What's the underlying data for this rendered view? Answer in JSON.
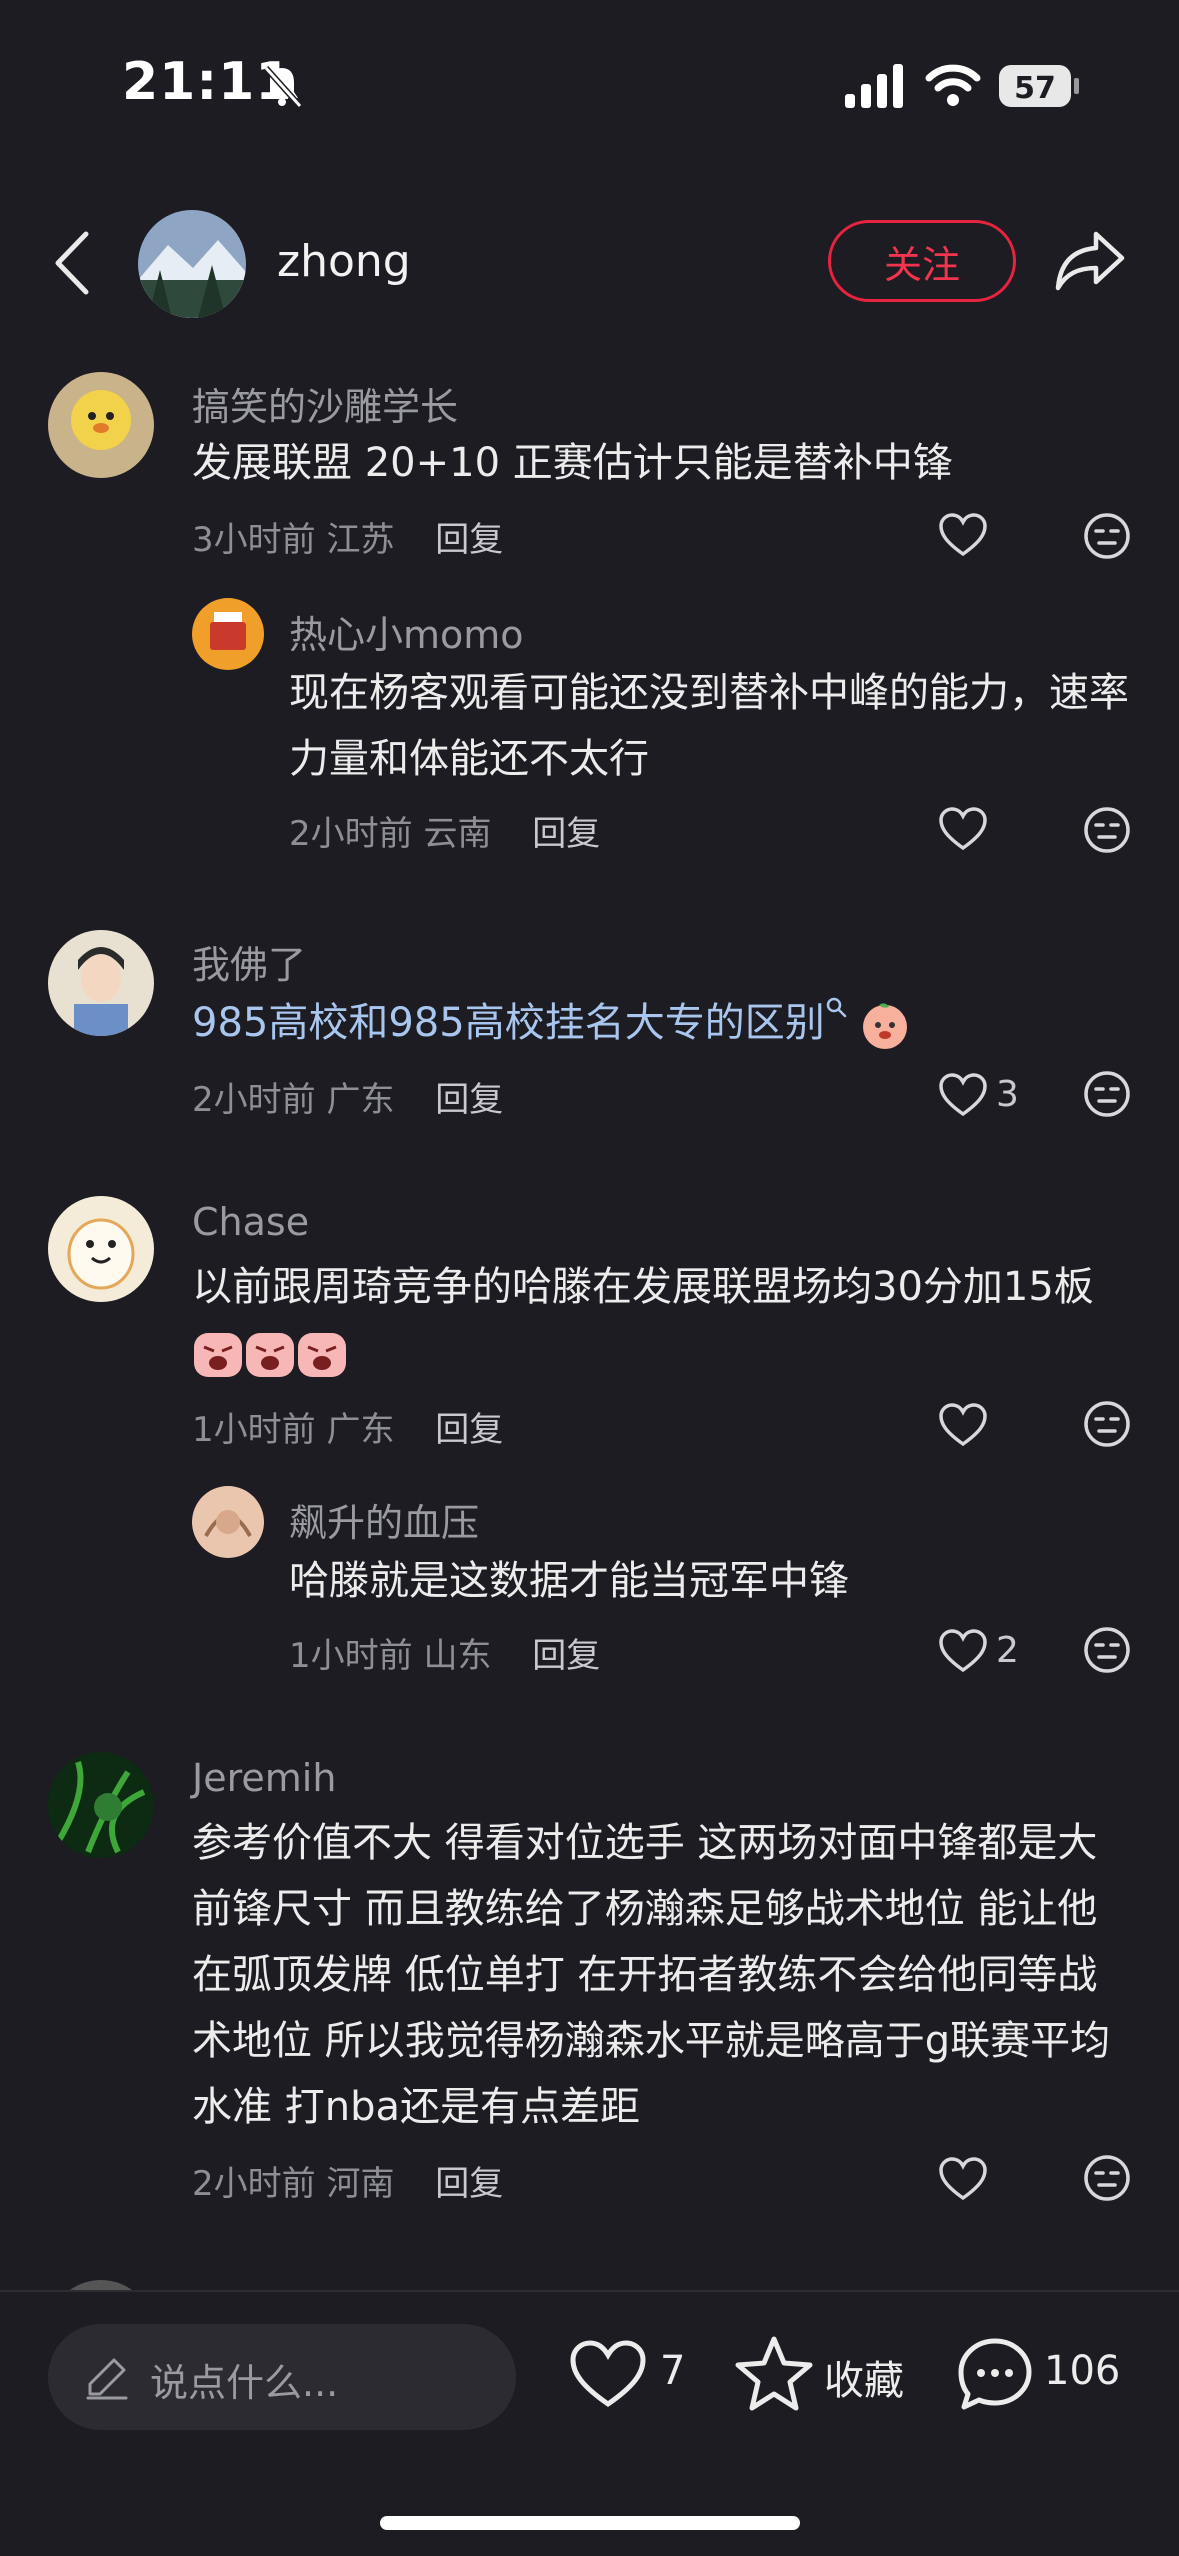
{
  "status_bar": {
    "time": "21:11",
    "battery": "57"
  },
  "header": {
    "username": "zhong",
    "follow_label": "关注"
  },
  "comments": [
    {
      "user": "搞笑的沙雕学长",
      "text": "发展联盟 20+10  正赛估计只能是替补中锋",
      "time": "3小时前",
      "location": "江苏",
      "reply_label": "回复",
      "likes": ""
    },
    {
      "user": "热心小momo",
      "text": "现在杨客观看可能还没到替补中峰的能力，速率力量和体能还不太行",
      "time": "2小时前",
      "location": "云南",
      "reply_label": "回复",
      "likes": ""
    },
    {
      "user": "我佛了",
      "text": "985高校和985高校挂名大专的区别",
      "time": "2小时前",
      "location": "广东",
      "reply_label": "回复",
      "likes": "3"
    },
    {
      "user": "Chase",
      "text": "以前跟周琦竞争的哈滕在发展联盟场均30分加15板",
      "time": "1小时前",
      "location": "广东",
      "reply_label": "回复",
      "likes": ""
    },
    {
      "user": "飙升的血压",
      "text": "哈滕就是这数据才能当冠军中锋",
      "time": "1小时前",
      "location": "山东",
      "reply_label": "回复",
      "likes": "2"
    },
    {
      "user": "Jeremih",
      "text": "参考价值不大 得看对位选手 这两场对面中锋都是大前锋尺寸  而且教练给了杨瀚森足够战术地位 能让他在弧顶发牌 低位单打 在开拓者教练不会给他同等战术地位 所以我觉得杨瀚森水平就是略高于g联赛平均水准 打nba还是有点差距",
      "time": "2小时前",
      "location": "河南",
      "reply_label": "回复",
      "likes": ""
    }
  ],
  "bottom_bar": {
    "input_placeholder": "说点什么...",
    "likes": "7",
    "favorite_label": "收藏",
    "comments_count": "106"
  },
  "colors": {
    "background": "#1c1c22",
    "accent": "#e8233f",
    "link": "#a9c6ee"
  }
}
